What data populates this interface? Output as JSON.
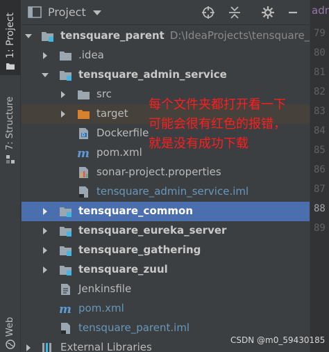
{
  "stripe": {
    "project_tab": "1: Project",
    "structure_tab": "7: Structure",
    "web_tab": "Web"
  },
  "header": {
    "title": "Project",
    "icons": [
      "project-view-icon",
      "dropdown-arrow-icon",
      "locate-icon",
      "collapse-all-icon",
      "gear-icon",
      "hide-icon"
    ]
  },
  "editor_tab": {
    "partial_name": "adm"
  },
  "tree": {
    "root": {
      "name": "tensquare_parent",
      "path": "D:\\IdeaProjects\\tensquare_parent"
    },
    "idea": ".idea",
    "admin_service": "tensquare_admin_service",
    "admin_children": {
      "src": "src",
      "target": "target",
      "dockerfile": "Dockerfile",
      "pom": "pom.xml",
      "sonar": "sonar-project.properties",
      "iml": "tensquare_admin_service.iml"
    },
    "common": "tensquare_common",
    "eureka": "tensquare_eureka_server",
    "gathering": "tensquare_gathering",
    "zuul": "tensquare_zuul",
    "jenkinsfile": "Jenkinsfile",
    "root_pom": "pom.xml",
    "root_iml": "tensquare_parent.iml",
    "external": "External Libraries"
  },
  "gutter": {
    "lines": [
      "79",
      "80",
      "81",
      "82",
      "83",
      "84",
      "85",
      "86",
      "87",
      "88",
      "89"
    ]
  },
  "annotation": {
    "line1": "每个文件夹都打开看一下",
    "line2": "可能会很有红色的报错，",
    "line3": "就是没有成功下载"
  },
  "watermark": "CSDN @m0_59430185",
  "colors": {
    "background": "#3c3f41",
    "selection": "#4b6eaf",
    "annotation": "#ff1e1e",
    "iml_text": "#6897bb"
  }
}
